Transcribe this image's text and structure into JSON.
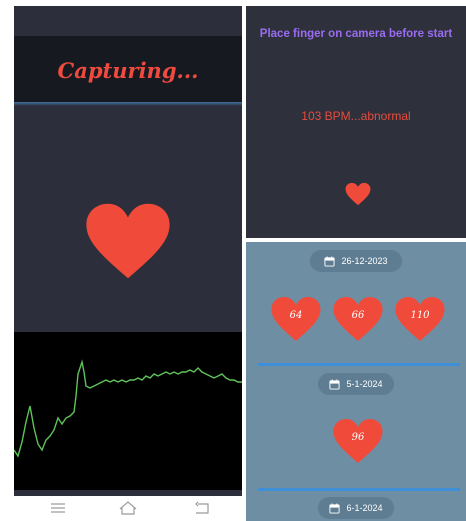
{
  "capture": {
    "status_text": "Capturing...",
    "heart_color": "#f04b3a",
    "waveform_color": "#5ec45a"
  },
  "measure": {
    "instruction": "Place finger on camera before start",
    "result_text": "103 BPM...abnormal",
    "accent_color": "#9b6cf2",
    "result_color": "#e74c3c"
  },
  "history": {
    "entries": [
      {
        "date": "26-12-2023",
        "readings": [
          "64",
          "66",
          "110"
        ]
      },
      {
        "date": "5-1-2024",
        "readings": [
          "96"
        ]
      },
      {
        "date": "6-1-2024",
        "readings": []
      }
    ],
    "divider_color": "#3d8fd8"
  },
  "navigation": {
    "icons": [
      "menu-icon",
      "home-icon",
      "back-icon"
    ]
  }
}
